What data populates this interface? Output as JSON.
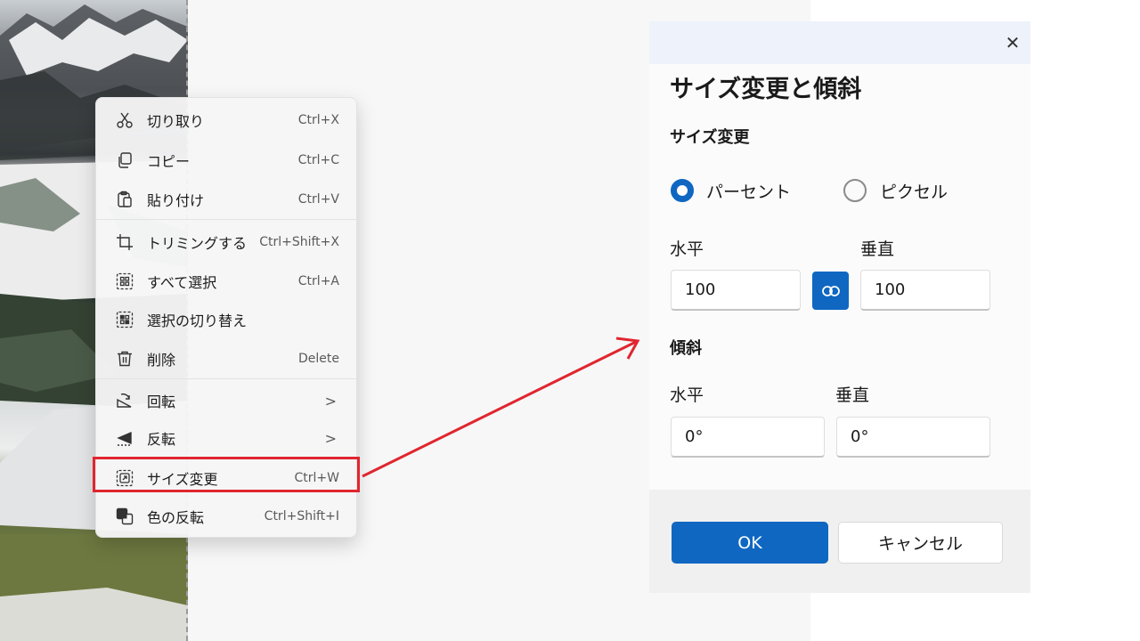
{
  "context_menu": {
    "items": [
      {
        "label": "切り取り",
        "shortcut": "Ctrl+X",
        "icon": "scissors-icon"
      },
      {
        "label": "コピー",
        "shortcut": "Ctrl+C",
        "icon": "copy-icon"
      },
      {
        "label": "貼り付け",
        "shortcut": "Ctrl+V",
        "icon": "paste-icon"
      },
      {
        "label": "トリミングする",
        "shortcut": "Ctrl+Shift+X",
        "icon": "crop-icon"
      },
      {
        "label": "すべて選択",
        "shortcut": "Ctrl+A",
        "icon": "select-all-icon"
      },
      {
        "label": "選択の切り替え",
        "shortcut": "",
        "icon": "invert-selection-icon"
      },
      {
        "label": "削除",
        "shortcut": "Delete",
        "icon": "trash-icon"
      },
      {
        "label": "回転",
        "chevron": ">",
        "icon": "rotate-icon"
      },
      {
        "label": "反転",
        "chevron": ">",
        "icon": "flip-icon"
      },
      {
        "label": "サイズ変更",
        "shortcut": "Ctrl+W",
        "icon": "resize-icon"
      },
      {
        "label": "色の反転",
        "shortcut": "Ctrl+Shift+I",
        "icon": "invert-colors-icon"
      }
    ]
  },
  "dialog": {
    "close_glyph": "✕",
    "title": "サイズ変更と傾斜",
    "resize": {
      "heading": "サイズ変更",
      "option_percent": "パーセント",
      "option_pixel": "ピクセル",
      "horizontal_label": "水平",
      "vertical_label": "垂直",
      "horizontal_value": "100",
      "vertical_value": "100"
    },
    "skew": {
      "heading": "傾斜",
      "horizontal_label": "水平",
      "vertical_label": "垂直",
      "horizontal_value": "0°",
      "vertical_value": "0°"
    },
    "ok_label": "OK",
    "cancel_label": "キャンセル"
  },
  "colors": {
    "accent": "#0f67c2",
    "highlight": "#e0262f"
  }
}
